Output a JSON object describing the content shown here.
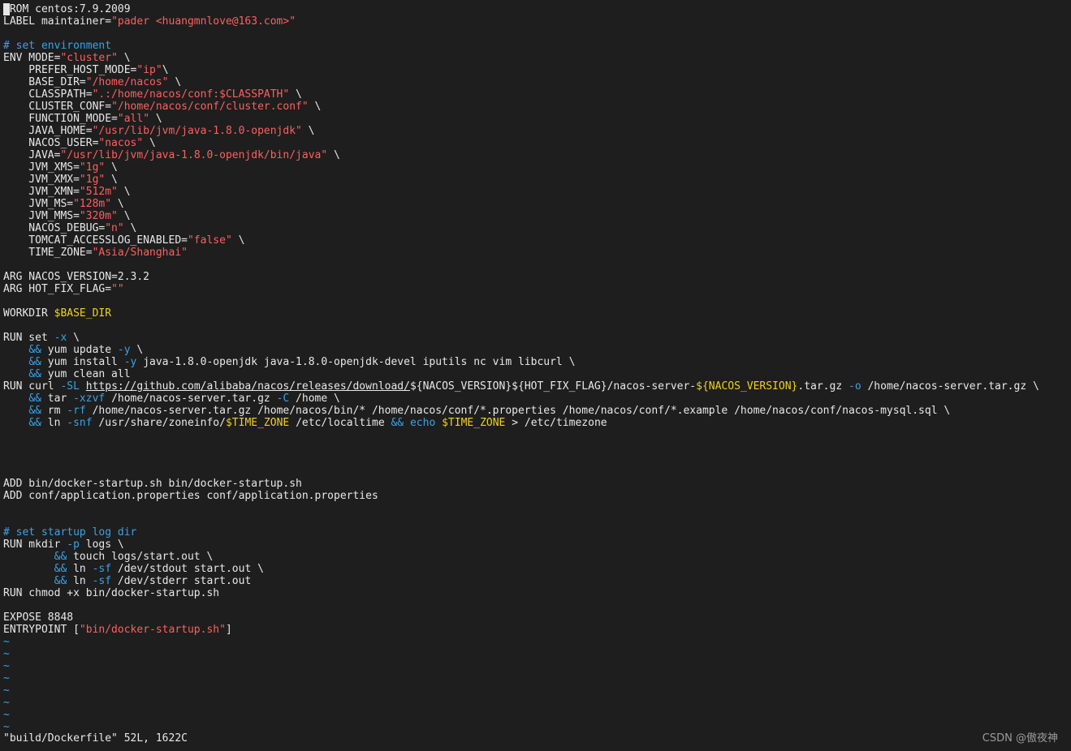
{
  "colors": {
    "background": "#1e1e1e",
    "text": "#e8e8e8",
    "string": "#ff5f5f",
    "comment": "#3aa2e8",
    "variable": "#f0d020",
    "operator": "#3aa2e8"
  },
  "lines": [
    {
      "row": 0,
      "segments": [
        [
          "plain",
          "FROM centos:7.9.2009"
        ]
      ]
    },
    {
      "row": 1,
      "segments": [
        [
          "plain",
          "LABEL maintainer="
        ],
        [
          "str",
          "\"pader <huangmnlove@163.com>\""
        ]
      ]
    },
    {
      "row": 3,
      "segments": [
        [
          "cmt",
          "# set environment"
        ]
      ]
    },
    {
      "row": 4,
      "segments": [
        [
          "plain",
          "ENV MODE="
        ],
        [
          "str",
          "\"cluster\""
        ],
        [
          "plain",
          " \\"
        ]
      ]
    },
    {
      "row": 5,
      "segments": [
        [
          "plain",
          "    PREFER_HOST_MODE="
        ],
        [
          "str",
          "\"ip\""
        ],
        [
          "plain",
          "\\"
        ]
      ]
    },
    {
      "row": 6,
      "segments": [
        [
          "plain",
          "    BASE_DIR="
        ],
        [
          "str",
          "\"/home/nacos\""
        ],
        [
          "plain",
          " \\"
        ]
      ]
    },
    {
      "row": 7,
      "segments": [
        [
          "plain",
          "    CLASSPATH="
        ],
        [
          "str",
          "\".:/home/nacos/conf:$CLASSPATH\""
        ],
        [
          "plain",
          " \\"
        ]
      ]
    },
    {
      "row": 8,
      "segments": [
        [
          "plain",
          "    CLUSTER_CONF="
        ],
        [
          "str",
          "\"/home/nacos/conf/cluster.conf\""
        ],
        [
          "plain",
          " \\"
        ]
      ]
    },
    {
      "row": 9,
      "segments": [
        [
          "plain",
          "    FUNCTION_MODE="
        ],
        [
          "str",
          "\"all\""
        ],
        [
          "plain",
          " \\"
        ]
      ]
    },
    {
      "row": 10,
      "segments": [
        [
          "plain",
          "    JAVA_HOME="
        ],
        [
          "str",
          "\"/usr/lib/jvm/java-1.8.0-openjdk\""
        ],
        [
          "plain",
          " \\"
        ]
      ]
    },
    {
      "row": 11,
      "segments": [
        [
          "plain",
          "    NACOS_USER="
        ],
        [
          "str",
          "\"nacos\""
        ],
        [
          "plain",
          " \\"
        ]
      ]
    },
    {
      "row": 12,
      "segments": [
        [
          "plain",
          "    JAVA="
        ],
        [
          "str",
          "\"/usr/lib/jvm/java-1.8.0-openjdk/bin/java\""
        ],
        [
          "plain",
          " \\"
        ]
      ]
    },
    {
      "row": 13,
      "segments": [
        [
          "plain",
          "    JVM_XMS="
        ],
        [
          "str",
          "\"1g\""
        ],
        [
          "plain",
          " \\"
        ]
      ]
    },
    {
      "row": 14,
      "segments": [
        [
          "plain",
          "    JVM_XMX="
        ],
        [
          "str",
          "\"1g\""
        ],
        [
          "plain",
          " \\"
        ]
      ]
    },
    {
      "row": 15,
      "segments": [
        [
          "plain",
          "    JVM_XMN="
        ],
        [
          "str",
          "\"512m\""
        ],
        [
          "plain",
          " \\"
        ]
      ]
    },
    {
      "row": 16,
      "segments": [
        [
          "plain",
          "    JVM_MS="
        ],
        [
          "str",
          "\"128m\""
        ],
        [
          "plain",
          " \\"
        ]
      ]
    },
    {
      "row": 17,
      "segments": [
        [
          "plain",
          "    JVM_MMS="
        ],
        [
          "str",
          "\"320m\""
        ],
        [
          "plain",
          " \\"
        ]
      ]
    },
    {
      "row": 18,
      "segments": [
        [
          "plain",
          "    NACOS_DEBUG="
        ],
        [
          "str",
          "\"n\""
        ],
        [
          "plain",
          " \\"
        ]
      ]
    },
    {
      "row": 19,
      "segments": [
        [
          "plain",
          "    TOMCAT_ACCESSLOG_ENABLED="
        ],
        [
          "str",
          "\"false\""
        ],
        [
          "plain",
          " \\"
        ]
      ]
    },
    {
      "row": 20,
      "segments": [
        [
          "plain",
          "    TIME_ZONE="
        ],
        [
          "str",
          "\"Asia/Shanghai\""
        ]
      ]
    },
    {
      "row": 22,
      "segments": [
        [
          "plain",
          "ARG NACOS_VERSION=2.3.2"
        ]
      ]
    },
    {
      "row": 23,
      "segments": [
        [
          "plain",
          "ARG HOT_FIX_FLAG="
        ],
        [
          "str",
          "\"\""
        ]
      ]
    },
    {
      "row": 25,
      "segments": [
        [
          "plain",
          "WORKDIR "
        ],
        [
          "var",
          "$BASE_DIR"
        ]
      ]
    },
    {
      "row": 27,
      "segments": [
        [
          "plain",
          "RUN set "
        ],
        [
          "op",
          "-x"
        ],
        [
          "plain",
          " \\"
        ]
      ]
    },
    {
      "row": 28,
      "segments": [
        [
          "plain",
          "    "
        ],
        [
          "op",
          "&&"
        ],
        [
          "plain",
          " yum update "
        ],
        [
          "op",
          "-y"
        ],
        [
          "plain",
          " \\"
        ]
      ]
    },
    {
      "row": 29,
      "segments": [
        [
          "plain",
          "    "
        ],
        [
          "op",
          "&&"
        ],
        [
          "plain",
          " yum install "
        ],
        [
          "op",
          "-y"
        ],
        [
          "plain",
          " java-1.8.0-openjdk java-1.8.0-openjdk-devel iputils nc vim libcurl \\"
        ]
      ]
    },
    {
      "row": 30,
      "segments": [
        [
          "plain",
          "    "
        ],
        [
          "op",
          "&&"
        ],
        [
          "plain",
          " yum clean all"
        ]
      ]
    },
    {
      "row": 31,
      "segments": [
        [
          "plain",
          "RUN curl "
        ],
        [
          "op",
          "-SL"
        ],
        [
          "plain",
          " "
        ],
        [
          "url",
          "https://github.com/alibaba/nacos/releases/download/"
        ],
        [
          "plain",
          "${NACOS_VERSION}${HOT_FIX_FLAG}/nacos-server-"
        ],
        [
          "var",
          "${NACOS_VERSION}"
        ],
        [
          "plain",
          ".tar.gz "
        ],
        [
          "op",
          "-o"
        ],
        [
          "plain",
          " /home/nacos-server.tar.gz \\"
        ]
      ]
    },
    {
      "row": 32,
      "segments": [
        [
          "plain",
          "    "
        ],
        [
          "op",
          "&&"
        ],
        [
          "plain",
          " tar "
        ],
        [
          "op",
          "-xzvf"
        ],
        [
          "plain",
          " /home/nacos-server.tar.gz "
        ],
        [
          "op",
          "-C"
        ],
        [
          "plain",
          " /home \\"
        ]
      ]
    },
    {
      "row": 33,
      "segments": [
        [
          "plain",
          "    "
        ],
        [
          "op",
          "&&"
        ],
        [
          "plain",
          " rm "
        ],
        [
          "op",
          "-rf"
        ],
        [
          "plain",
          " /home/nacos-server.tar.gz /home/nacos/bin/* /home/nacos/conf/*.properties /home/nacos/conf/*.example /home/nacos/conf/nacos-mysql.sql \\"
        ]
      ]
    },
    {
      "row": 34,
      "segments": [
        [
          "plain",
          "    "
        ],
        [
          "op",
          "&&"
        ],
        [
          "plain",
          " ln "
        ],
        [
          "op",
          "-snf"
        ],
        [
          "plain",
          " /usr/share/zoneinfo/"
        ],
        [
          "var",
          "$TIME_ZONE"
        ],
        [
          "plain",
          " /etc/localtime "
        ],
        [
          "op",
          "&&"
        ],
        [
          "plain",
          " "
        ],
        [
          "op",
          "echo"
        ],
        [
          "plain",
          " "
        ],
        [
          "var",
          "$TIME_ZONE"
        ],
        [
          "plain",
          " > /etc/timezone"
        ]
      ]
    },
    {
      "row": 39,
      "segments": [
        [
          "plain",
          "ADD bin/docker-startup.sh bin/docker-startup.sh"
        ]
      ]
    },
    {
      "row": 40,
      "segments": [
        [
          "plain",
          "ADD conf/application.properties conf/application.properties"
        ]
      ]
    },
    {
      "row": 43,
      "segments": [
        [
          "cmt",
          "# set startup log dir"
        ]
      ]
    },
    {
      "row": 44,
      "segments": [
        [
          "plain",
          "RUN mkdir "
        ],
        [
          "op",
          "-p"
        ],
        [
          "plain",
          " logs \\"
        ]
      ]
    },
    {
      "row": 45,
      "segments": [
        [
          "plain",
          "        "
        ],
        [
          "op",
          "&&"
        ],
        [
          "plain",
          " touch logs/start.out \\"
        ]
      ]
    },
    {
      "row": 46,
      "segments": [
        [
          "plain",
          "        "
        ],
        [
          "op",
          "&&"
        ],
        [
          "plain",
          " ln "
        ],
        [
          "op",
          "-sf"
        ],
        [
          "plain",
          " /dev/stdout start.out \\"
        ]
      ]
    },
    {
      "row": 47,
      "segments": [
        [
          "plain",
          "        "
        ],
        [
          "op",
          "&&"
        ],
        [
          "plain",
          " ln "
        ],
        [
          "op",
          "-sf"
        ],
        [
          "plain",
          " /dev/stderr start.out"
        ]
      ]
    },
    {
      "row": 48,
      "segments": [
        [
          "plain",
          "RUN chmod +x bin/docker-startup.sh"
        ]
      ]
    },
    {
      "row": 50,
      "segments": [
        [
          "plain",
          "EXPOSE 8848"
        ]
      ]
    },
    {
      "row": 51,
      "segments": [
        [
          "plain",
          "ENTRYPOINT ["
        ],
        [
          "str",
          "\"bin/docker-startup.sh\""
        ],
        [
          "plain",
          "]"
        ]
      ]
    }
  ],
  "tilde_rows": [
    52,
    53,
    54,
    55,
    56,
    57,
    58,
    59
  ],
  "tilde_char": "~",
  "status_line": "\"build/Dockerfile\" 52L, 1622C",
  "watermark": "CSDN @傲夜神"
}
